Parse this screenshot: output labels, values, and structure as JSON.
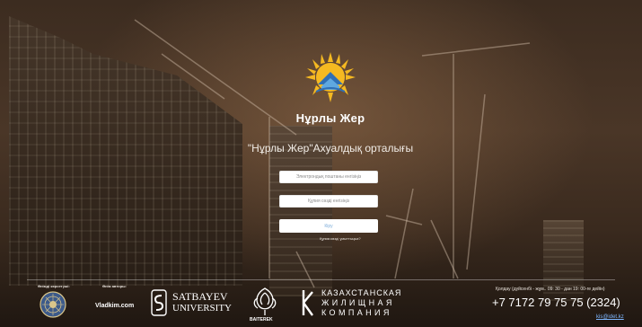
{
  "brand": {
    "name": "Нұрлы Жер",
    "subtitle": "\"Нұрлы Жер\"Ахуалдық орталығы"
  },
  "form": {
    "email_placeholder": "Электрондық поштаны енгізіңіз",
    "password_placeholder": "Құпия сөзді енгізіңіз",
    "login_label": "Кіру",
    "forgot_link": "Құпия сөзді ұмыттыңыз?"
  },
  "footer": {
    "customer_label": "Өнімді көрсетушi:",
    "author_label": "Өнім авторы:",
    "author_name": "Vladkim.com",
    "satbayev_line1": "SATBAYEV",
    "satbayev_line2": "UNIVERSITY",
    "baiterek": "BAITEREK",
    "kzh_line1": "КАЗАХСТАНСКАЯ",
    "kzh_line2": "ЖИЛИЩНАЯ",
    "kzh_line3": "КОМПАНИЯ",
    "hours": "Қолдау (дүйсенбі - жұм.. 09: 30 - дан 19: 00-ге дейін)",
    "phone": "+7 7172 79 75 75 (2324)",
    "email": "kis@idet.kz"
  }
}
